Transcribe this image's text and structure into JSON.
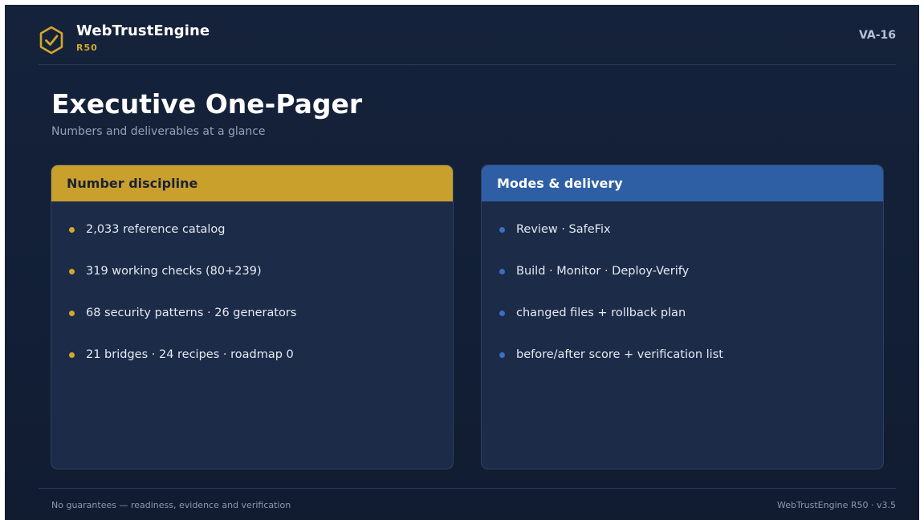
{
  "header": {
    "brand": "WebTrustEngine",
    "release": "R50",
    "slide_code": "VA-16",
    "logo_icon": "hexagon-check-icon"
  },
  "main": {
    "title": "Executive One-Pager",
    "subtitle": "Numbers and deliverables at a glance"
  },
  "cards": [
    {
      "heading": "Number discipline",
      "accent": "#c9a02b",
      "items": [
        "2,033 reference catalog",
        "319 working checks (80+239)",
        "68 security patterns · 26 generators",
        "21 bridges · 24 recipes · roadmap 0"
      ]
    },
    {
      "heading": "Modes & delivery",
      "accent": "#2e5fa4",
      "items": [
        "Review · SafeFix",
        "Build · Monitor · Deploy-Verify",
        "changed files + rollback plan",
        "before/after score + verification list"
      ]
    }
  ],
  "footer": {
    "disclaimer": "No guarantees — readiness, evidence and verification",
    "version": "WebTrustEngine R50 · v3.5"
  },
  "colors": {
    "background": "#13203a",
    "gold": "#d4a72c",
    "blue": "#2e5fa4"
  }
}
